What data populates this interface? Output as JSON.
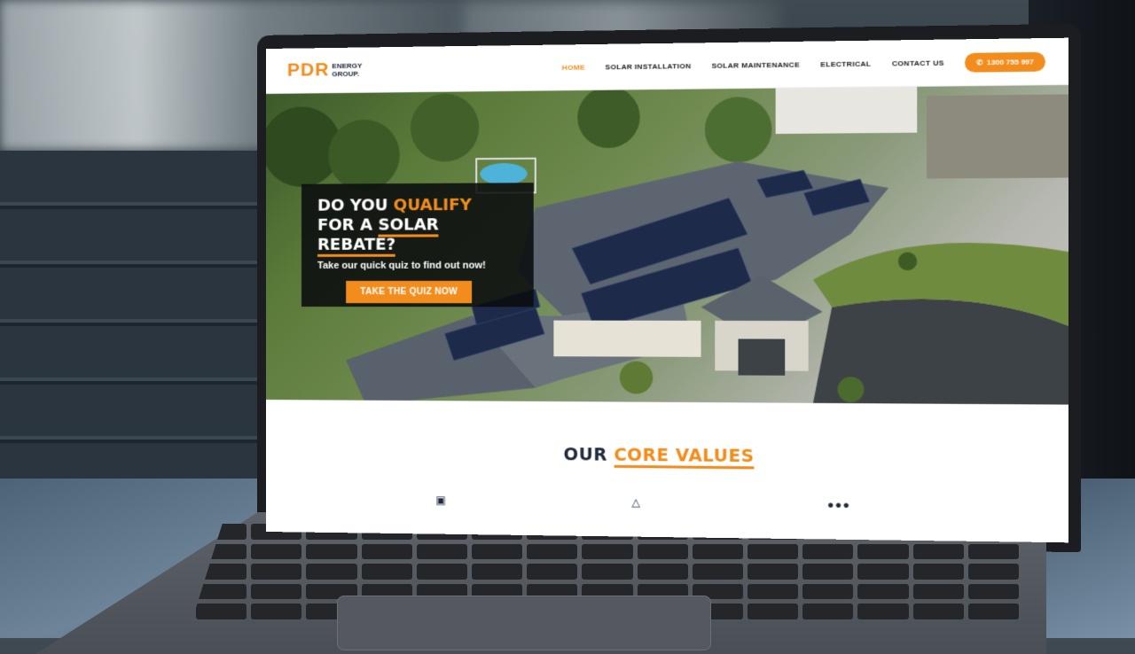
{
  "site": {
    "logo": {
      "mark": "PDR",
      "sub_line1": "ENERGY",
      "sub_line2": "GROUP."
    },
    "nav": {
      "items": [
        {
          "label": "HOME",
          "active": true
        },
        {
          "label": "SOLAR INSTALLATION",
          "active": false
        },
        {
          "label": "SOLAR MAINTENANCE",
          "active": false
        },
        {
          "label": "ELECTRICAL",
          "active": false
        },
        {
          "label": "CONTACT US",
          "active": false
        }
      ],
      "phone_icon": "phone-icon",
      "phone": "1300 755 997"
    },
    "hero": {
      "line1_prefix": "DO YOU ",
      "line1_highlight": "QUALIFY",
      "line2_prefix": "FOR A ",
      "line2_underlined": "SOLAR REBATE?",
      "subtitle": "Take our quick quiz to find out now!",
      "cta_label": "TAKE THE QUIZ NOW"
    },
    "values": {
      "title_prefix": "OUR ",
      "title_highlight": "CORE VALUES",
      "icons": [
        "camera-icon",
        "shield-icon",
        "team-icon"
      ]
    }
  },
  "colors": {
    "accent": "#f28c1c",
    "navy": "#1e2a3a",
    "overlay": "#0a0c0e"
  }
}
